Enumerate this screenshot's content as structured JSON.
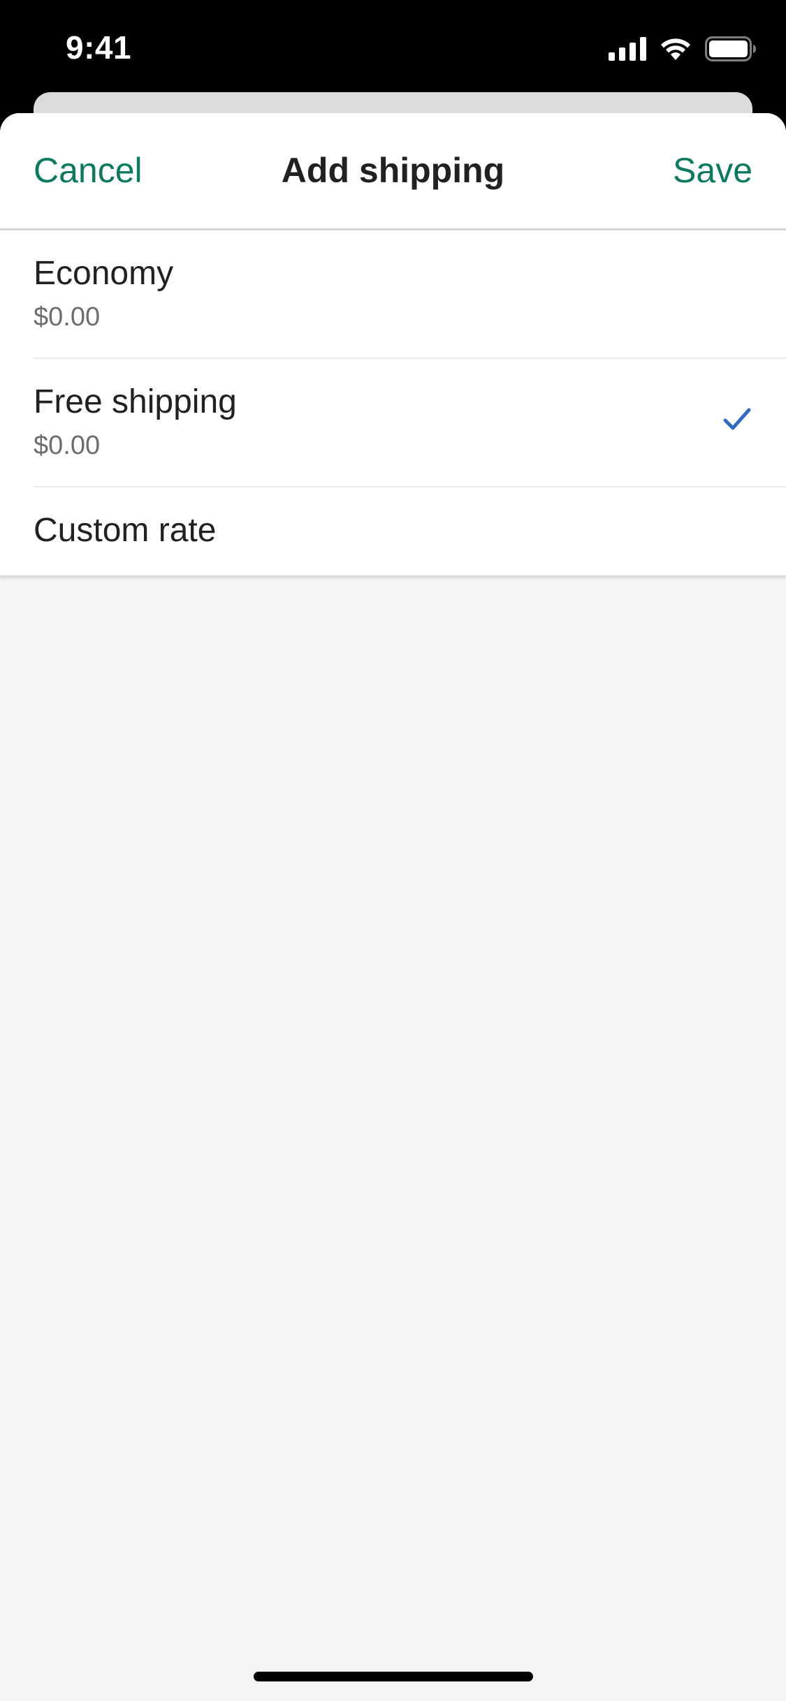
{
  "status_bar": {
    "time": "9:41",
    "icons": [
      "cellular-signal-icon",
      "wifi-icon",
      "battery-icon"
    ]
  },
  "header": {
    "cancel_label": "Cancel",
    "title": "Add shipping",
    "save_label": "Save"
  },
  "options": [
    {
      "label": "Economy",
      "price": "$0.00",
      "selected": false
    },
    {
      "label": "Free shipping",
      "price": "$0.00",
      "selected": true
    },
    {
      "label": "Custom rate",
      "selected": false
    }
  ],
  "colors": {
    "accent": "#0b7a61",
    "check": "#2f6cc1",
    "text_primary": "#212121",
    "text_secondary": "#6d6d6d",
    "sheet_background": "#f4f4f4"
  }
}
